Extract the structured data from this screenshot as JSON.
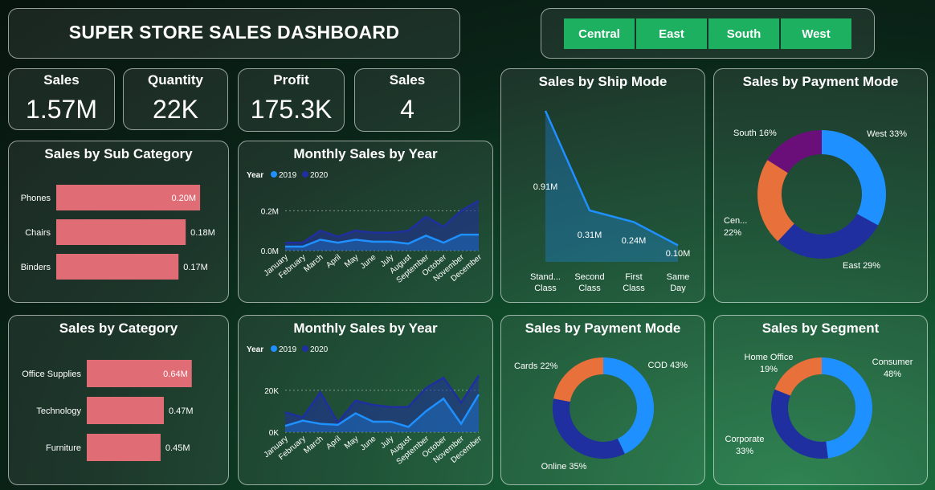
{
  "header": {
    "title": "SUPER STORE SALES DASHBOARD"
  },
  "slicer": {
    "regions": [
      "Central",
      "East",
      "South",
      "West"
    ]
  },
  "kpis": [
    {
      "label": "Sales",
      "value": "1.57M"
    },
    {
      "label": "Quantity",
      "value": "22K"
    },
    {
      "label": "Profit",
      "value": "175.3K"
    },
    {
      "label": "Sales",
      "value": "4"
    }
  ],
  "colors": {
    "bar": "#e06c75",
    "series2019": "#1e90ff",
    "series2020": "#1f2fa0",
    "orange": "#e8703a",
    "purple": "#6a0f7a"
  },
  "chart_data": [
    {
      "id": "sub_category",
      "type": "bar",
      "orientation": "horizontal",
      "title": "Sales by Sub Category",
      "categories": [
        "Phones",
        "Chairs",
        "Binders"
      ],
      "values": [
        0.2,
        0.18,
        0.17
      ],
      "data_labels": [
        "0.20M",
        "0.18M",
        "0.17M"
      ],
      "xlim": [
        0,
        0.22
      ]
    },
    {
      "id": "monthly_1",
      "type": "area",
      "title": "Monthly Sales by Year",
      "legend_title": "Year",
      "x": [
        "January",
        "February",
        "March",
        "April",
        "May",
        "June",
        "July",
        "August",
        "September",
        "October",
        "November",
        "December"
      ],
      "series": [
        {
          "name": "2019",
          "values": [
            0.02,
            0.02,
            0.055,
            0.04,
            0.055,
            0.045,
            0.045,
            0.035,
            0.075,
            0.04,
            0.08,
            0.08
          ]
        },
        {
          "name": "2020",
          "values": [
            0.04,
            0.04,
            0.1,
            0.07,
            0.1,
            0.09,
            0.09,
            0.1,
            0.17,
            0.12,
            0.2,
            0.25
          ]
        }
      ],
      "yticks": [
        0,
        0.2
      ],
      "ytick_labels": [
        "0.0M",
        "0.2M"
      ],
      "ylim": [
        0,
        0.25
      ],
      "legend": "top-left"
    },
    {
      "id": "ship_mode",
      "type": "area",
      "title": "Sales by Ship Mode",
      "categories": [
        "Stand...\nClass",
        "Second\nClass",
        "First\nClass",
        "Same\nDay"
      ],
      "values": [
        0.91,
        0.31,
        0.24,
        0.1
      ],
      "data_labels": [
        "0.91M",
        "0.31M",
        "0.24M",
        "0.10M"
      ],
      "ylim": [
        0,
        0.91
      ]
    },
    {
      "id": "payment_mode_1",
      "type": "pie",
      "title": "Sales by Payment Mode",
      "labels": [
        "West 33%",
        "East 29%",
        "Cen...\n22%",
        "South 16%"
      ],
      "values": [
        33,
        29,
        22,
        16
      ],
      "colors": [
        "#1e90ff",
        "#1f2fa0",
        "#e8703a",
        "#6a0f7a"
      ]
    },
    {
      "id": "category",
      "type": "bar",
      "orientation": "horizontal",
      "title": "Sales by Category",
      "categories": [
        "Office Supplies",
        "Technology",
        "Furniture"
      ],
      "values": [
        0.64,
        0.47,
        0.45
      ],
      "data_labels": [
        "0.64M",
        "0.47M",
        "0.45M"
      ],
      "xlim": [
        0,
        0.7
      ]
    },
    {
      "id": "monthly_2",
      "type": "area",
      "title": "Monthly Sales by Year",
      "legend_title": "Year",
      "x": [
        "January",
        "February",
        "March",
        "April",
        "May",
        "June",
        "July",
        "August",
        "September",
        "October",
        "November",
        "December"
      ],
      "series": [
        {
          "name": "2019",
          "values": [
            3000,
            5500,
            4000,
            3500,
            9000,
            5000,
            5000,
            2500,
            10000,
            16000,
            4000,
            18000
          ]
        },
        {
          "name": "2020",
          "values": [
            9500,
            7000,
            19000,
            4500,
            15000,
            13000,
            12000,
            12000,
            21000,
            26000,
            14000,
            27000
          ]
        }
      ],
      "yticks": [
        0,
        20000
      ],
      "ytick_labels": [
        "0K",
        "20K"
      ],
      "ylim": [
        0,
        28000
      ],
      "legend": "top-left"
    },
    {
      "id": "payment_mode_2",
      "type": "pie",
      "title": "Sales by Payment Mode",
      "labels": [
        "COD 43%",
        "Online 35%",
        "Cards 22%"
      ],
      "values": [
        43,
        35,
        22
      ],
      "colors": [
        "#1e90ff",
        "#1f2fa0",
        "#e8703a"
      ]
    },
    {
      "id": "segment",
      "type": "pie",
      "title": "Sales by Segment",
      "labels": [
        "Consumer\n48%",
        "Corporate\n33%",
        "Home Office\n19%"
      ],
      "values": [
        48,
        33,
        19
      ],
      "colors": [
        "#1e90ff",
        "#1f2fa0",
        "#e8703a"
      ]
    }
  ]
}
